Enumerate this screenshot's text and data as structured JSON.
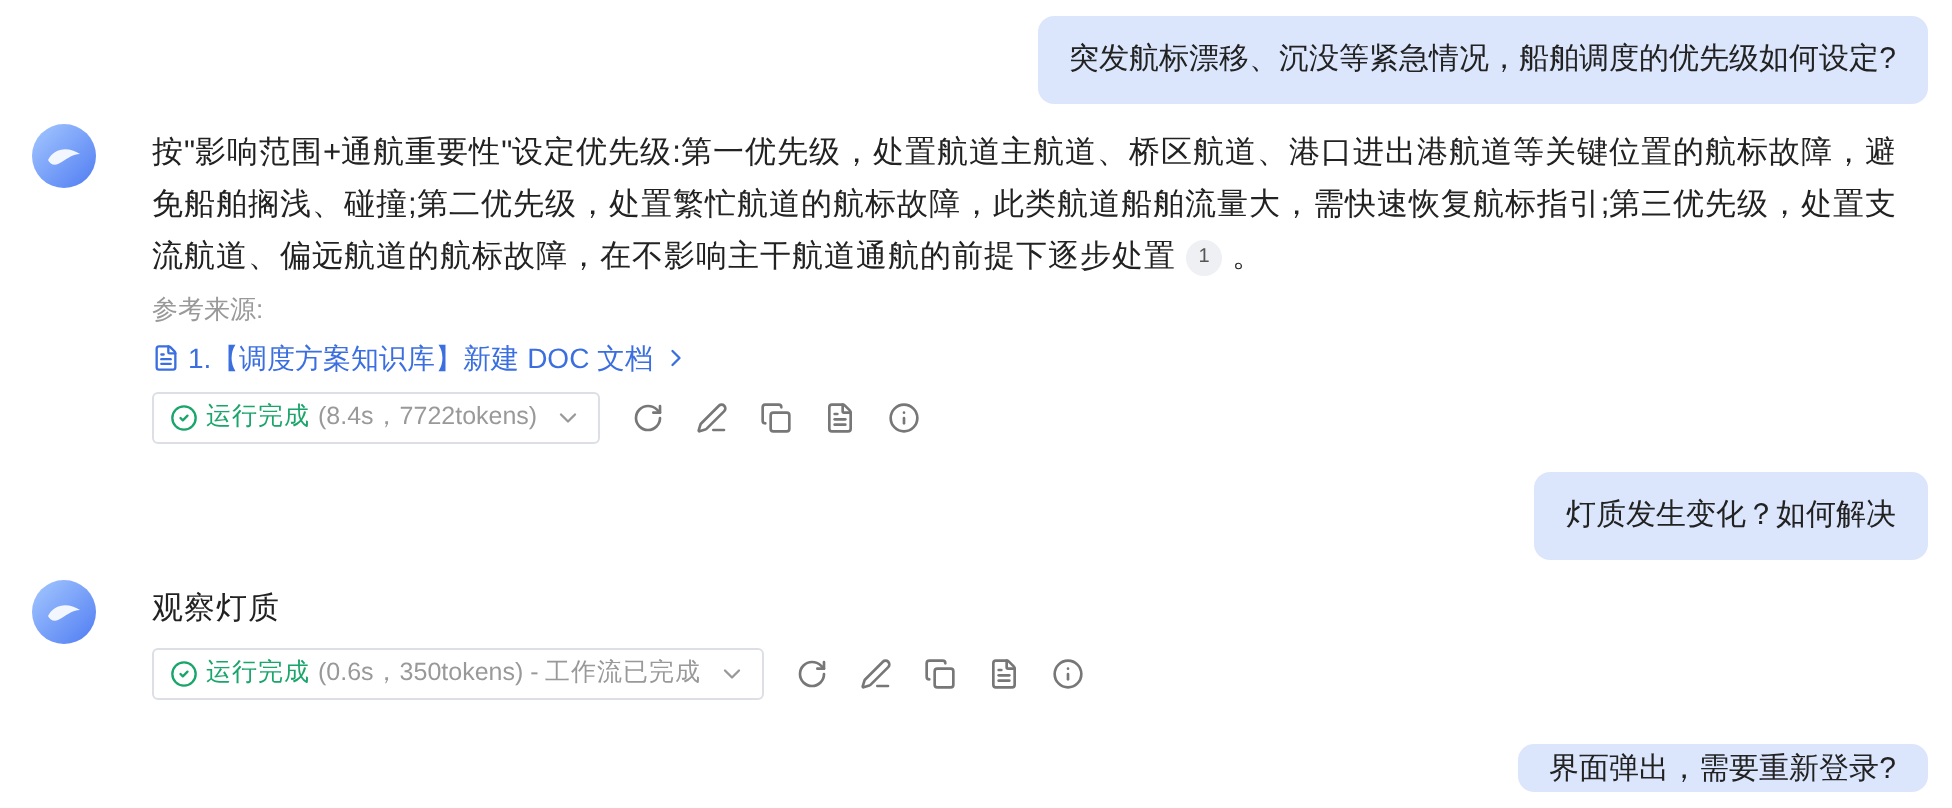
{
  "messages": [
    {
      "kind": "user",
      "text": "突发航标漂移、沉没等紧急情况，船舶调度的优先级如何设定?"
    },
    {
      "kind": "bot",
      "text": "按\"影响范围+通航重要性\"设定优先级:第一优先级，处置航道主航道、桥区航道、港口进出港航道等关键位置的航标故障，避免船舶搁浅、碰撞;第二优先级，处置繁忙航道的航标故障，此类航道船舶流量大，需快速恢复航标指引;第三优先级，处置支流航道、偏远航道的航标故障，在不影响主干航道通航的前提下逐步处置",
      "citation": "1",
      "tail": "。",
      "sources_label": "参考来源:",
      "sources": [
        "1.【调度方案知识库】新建 DOC 文档"
      ],
      "status": "运行完成",
      "status_detail": "(8.4s，7722tokens)"
    },
    {
      "kind": "user",
      "text": "灯质发生变化？如何解决"
    },
    {
      "kind": "bot",
      "text": "观察灯质",
      "status": "运行完成",
      "status_detail": "(0.6s，350tokens) - 工作流已完成"
    },
    {
      "kind": "user",
      "text": "界面弹出，需要重新登录?"
    }
  ]
}
